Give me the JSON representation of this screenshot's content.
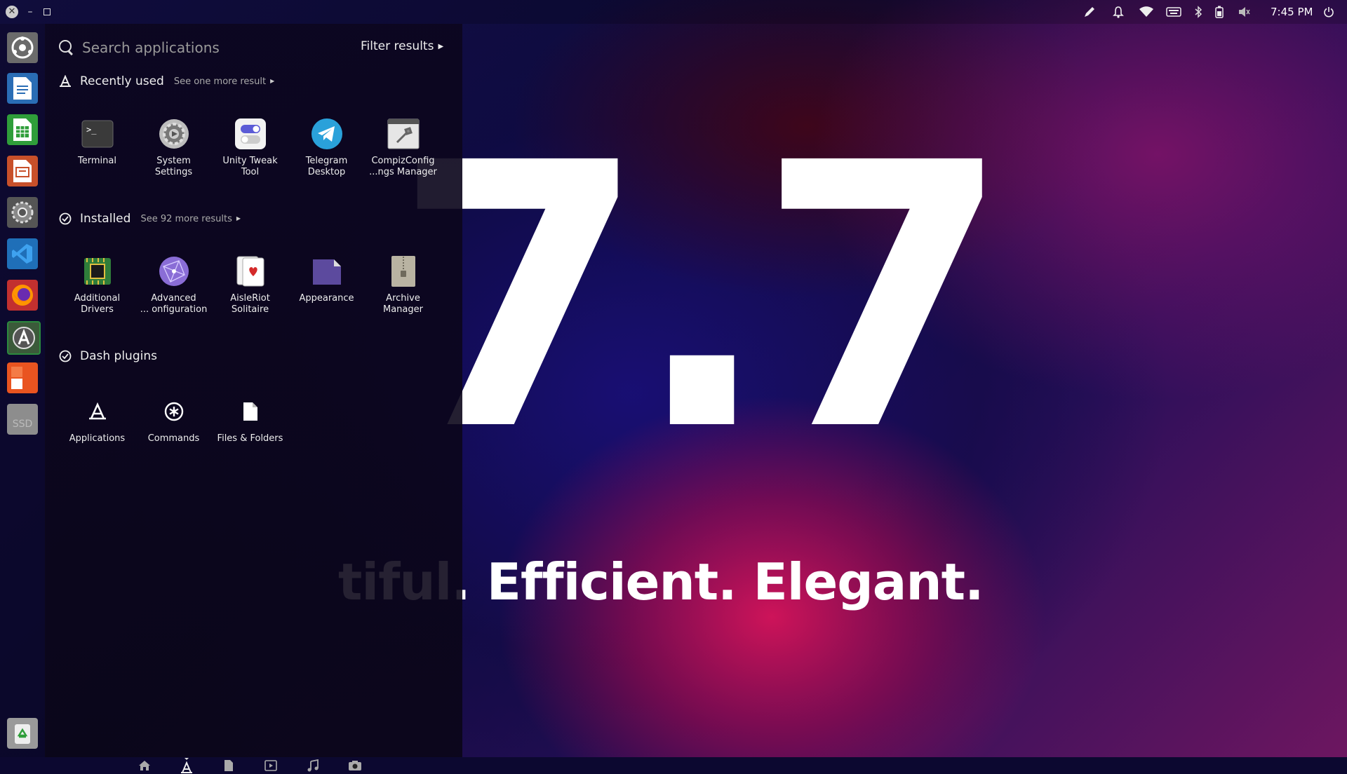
{
  "wallpaper": {
    "version": "7.7",
    "tagline": "tiful. Efficient. Elegant."
  },
  "topbar": {
    "close_label": "✕",
    "minimize_label": "–",
    "tray_icons": [
      "pen-icon",
      "bell-icon",
      "wifi-icon",
      "keyboard-icon",
      "bluetooth-icon",
      "battery-icon",
      "volume-icon",
      "power-icon"
    ],
    "clock": "7:45 PM"
  },
  "launcher": {
    "apps": [
      "dash-home",
      "libreoffice-writer",
      "libreoffice-calc",
      "libreoffice-impress",
      "system-settings",
      "vscode",
      "firefox",
      "software-updater",
      "ubuntu-software",
      "ssd-drive",
      "trash"
    ],
    "ssd_label": "SSD"
  },
  "search": {
    "placeholder": "Search applications",
    "filter_label": "Filter results"
  },
  "sections": {
    "recent": {
      "title": "Recently used",
      "more": "See one more result",
      "apps": [
        {
          "line1": "Terminal",
          "line2": ""
        },
        {
          "line1": "System",
          "line2": "Settings"
        },
        {
          "line1": "Unity Tweak",
          "line2": "Tool"
        },
        {
          "line1": "Telegram",
          "line2": "Desktop"
        },
        {
          "line1": "CompizConfig",
          "line2": "...ngs Manager"
        }
      ]
    },
    "installed": {
      "title": "Installed",
      "more": "See 92 more results",
      "apps": [
        {
          "line1": "Additional",
          "line2": "Drivers"
        },
        {
          "line1": "Advanced",
          "line2": "... onfiguration"
        },
        {
          "line1": "AisleRiot",
          "line2": "Solitaire"
        },
        {
          "line1": "Appearance",
          "line2": ""
        },
        {
          "line1": "Archive",
          "line2": "Manager"
        }
      ]
    },
    "plugins": {
      "title": "Dash plugins",
      "apps": [
        {
          "line1": "Applications"
        },
        {
          "line1": "Commands"
        },
        {
          "line1": "Files & Folders"
        }
      ]
    }
  },
  "lenses": [
    "home-lens-icon",
    "applications-lens-icon",
    "files-lens-icon",
    "video-lens-icon",
    "music-lens-icon",
    "photo-lens-icon"
  ],
  "colors": {
    "accent": "#e95420",
    "dash_bg": "#0c061e"
  }
}
